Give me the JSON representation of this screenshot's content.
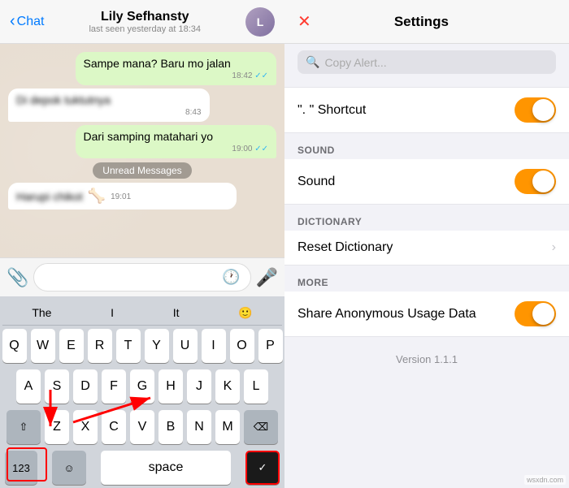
{
  "chat": {
    "back_label": "Chat",
    "contact_name": "Lily Sefhansty",
    "contact_status": "last seen yesterday at 18:34",
    "avatar_initials": "L",
    "messages": [
      {
        "id": 1,
        "type": "out",
        "text": "Sampe mana? Baru mo jalan",
        "time": "18:42",
        "ticks": "✓✓",
        "blurred": false
      },
      {
        "id": 2,
        "type": "in",
        "text": "Di depok tuktutnya",
        "time": "8:43",
        "blurred": true
      },
      {
        "id": 3,
        "type": "out",
        "text": "Dari samping matahari yo",
        "time": "19:00",
        "ticks": "✓✓",
        "blurred": false
      },
      {
        "id": 4,
        "type": "in",
        "text": "Harupi chikot",
        "time": "19:01",
        "blurred": true
      }
    ],
    "unread_label": "Unread Messages",
    "input_placeholder": "",
    "suggestions": [
      "The",
      "I",
      "It"
    ],
    "keyboard": {
      "row1": [
        "Q",
        "W",
        "E",
        "R",
        "T",
        "Y",
        "U",
        "I",
        "O",
        "P"
      ],
      "row2": [
        "A",
        "S",
        "D",
        "F",
        "G",
        "H",
        "J",
        "K",
        "L"
      ],
      "row3": [
        "Z",
        "X",
        "C",
        "V",
        "B",
        "N",
        "M"
      ],
      "num_label": "123",
      "return_label": "↩"
    }
  },
  "settings": {
    "title": "Settings",
    "close_icon": "✕",
    "search_placeholder": "Copy Alert...",
    "sections": [
      {
        "header": "",
        "items": [
          {
            "label": "\".\" Shortcut",
            "type": "toggle",
            "value": true
          }
        ]
      },
      {
        "header": "SOUND",
        "items": [
          {
            "label": "Sound",
            "type": "toggle",
            "value": true
          }
        ]
      },
      {
        "header": "DICTIONARY",
        "items": [
          {
            "label": "Reset Dictionary",
            "type": "chevron"
          }
        ]
      },
      {
        "header": "MORE",
        "items": [
          {
            "label": "Share Anonymous Usage Data",
            "type": "toggle",
            "value": true
          }
        ]
      }
    ],
    "version": "Version 1.1.1"
  }
}
